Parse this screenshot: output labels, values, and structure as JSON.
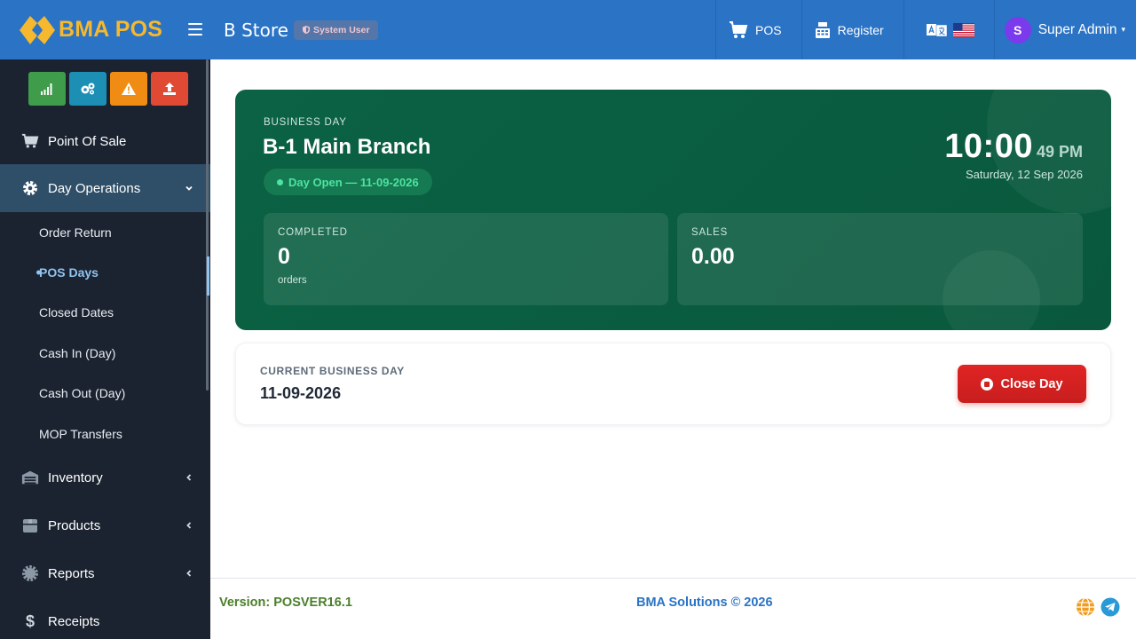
{
  "brand": {
    "name": "BMA POS",
    "color": "#f5b82e"
  },
  "colors": {
    "header": "#2a73c5",
    "sidebar": "#1b2330",
    "hero": "#0a5c40",
    "danger": "#d02222"
  },
  "header": {
    "store_name": "B Store",
    "role_badge": "System User",
    "links": [
      {
        "label": "POS",
        "icon": "cart-icon"
      },
      {
        "label": "Register",
        "icon": "cash-register-icon"
      }
    ],
    "language_icons": [
      "translate-icon",
      "us-flag-icon"
    ],
    "user": {
      "initial": "S",
      "name": "Super Admin"
    }
  },
  "sidebar": {
    "quick_buttons": [
      {
        "icon": "signal-bars-icon",
        "color": "#3e9c4b"
      },
      {
        "icon": "gears-icon",
        "color": "#1d8fb5"
      },
      {
        "icon": "warning-icon",
        "color": "#f08c14"
      },
      {
        "icon": "upload-icon",
        "color": "#e04a35"
      }
    ],
    "items": [
      {
        "label": "Point Of Sale",
        "icon": "cart-icon"
      },
      {
        "label": "Day Operations",
        "icon": "gear-icon",
        "expanded": true
      },
      {
        "label": "Inventory",
        "icon": "warehouse-icon"
      },
      {
        "label": "Products",
        "icon": "box-icon"
      },
      {
        "label": "Reports",
        "icon": "gear-cog-icon"
      },
      {
        "label": "Receipts",
        "icon": "dollar-icon"
      }
    ],
    "sub_items": [
      {
        "label": "Order Return"
      },
      {
        "label": "POS Days",
        "current": true
      },
      {
        "label": "Closed Dates"
      },
      {
        "label": "Cash In (Day)"
      },
      {
        "label": "Cash Out (Day)"
      },
      {
        "label": "MOP Transfers"
      }
    ]
  },
  "hero": {
    "section_label": "BUSINESS DAY",
    "branch": "B-1 Main Branch",
    "status": "Day Open — 11-09-2026",
    "time": "10:00",
    "seconds": "49 PM",
    "date": "Saturday, 12 Sep 2026",
    "stats": [
      {
        "label": "COMPLETED",
        "value": "0",
        "sub": "orders"
      },
      {
        "label": "SALES",
        "value": "0.00",
        "sub": ""
      }
    ]
  },
  "current_day": {
    "label": "CURRENT BUSINESS DAY",
    "value": "11-09-2026",
    "close_label": "Close Day"
  },
  "footer": {
    "version": "Version: POSVER16.1",
    "copyright": "BMA Solutions © 2026",
    "icons": [
      "globe-icon",
      "telegram-icon"
    ]
  }
}
